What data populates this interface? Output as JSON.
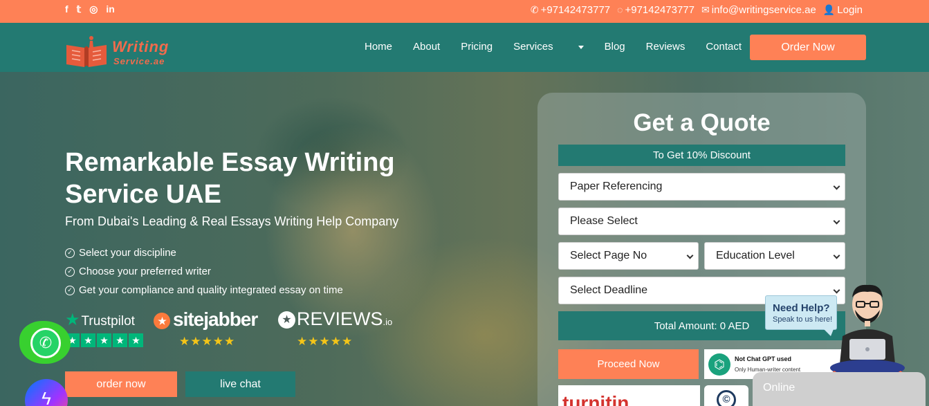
{
  "topbar": {
    "social": [
      "f",
      "t",
      "ig",
      "in"
    ],
    "phone": "+97142473777",
    "whatsapp": "+97142473777",
    "email": "info@writingservice.ae",
    "login": "Login"
  },
  "logo": {
    "line1": "Writing",
    "line2": "Service.ae"
  },
  "nav": {
    "items": [
      "Home",
      "About",
      "Pricing",
      "Services",
      "Blog",
      "Reviews",
      "Contact"
    ],
    "order_button": "Order Now"
  },
  "hero": {
    "title": "Remarkable Essay Writing Service UAE",
    "subtitle": "From Dubai's Leading & Real Essays Writing Help Company",
    "checks": [
      "Select your discipline",
      "Choose your preferred writer",
      "Get your compliance and quality integrated essay on time"
    ],
    "badges": {
      "trustpilot": "Trustpilot",
      "sitejabber": "sitejabber",
      "reviews": "REVIEWS",
      "reviews_suffix": ".io",
      "stars": "★★★★★"
    },
    "order_now": "order now",
    "live_chat": "live chat"
  },
  "quote": {
    "title": "Get a Quote",
    "banner": "To Get 10% Discount",
    "referencing": "Paper Referencing",
    "please_select": "Please Select",
    "page_no": "Select Page No",
    "education": "Education Level",
    "deadline": "Select Deadline",
    "total": "Total Amount: 0 AED",
    "proceed": "Proceed Now",
    "gpt_line1": "Not Chat GPT used",
    "gpt_line2": "Only Human-writer content",
    "turnitin": "turnitin"
  },
  "widgets": {
    "help_title": "Need Help?",
    "help_sub": "Speak to us here!",
    "online": "Online"
  },
  "colors": {
    "orange": "#fe8156",
    "teal": "#237a72"
  }
}
